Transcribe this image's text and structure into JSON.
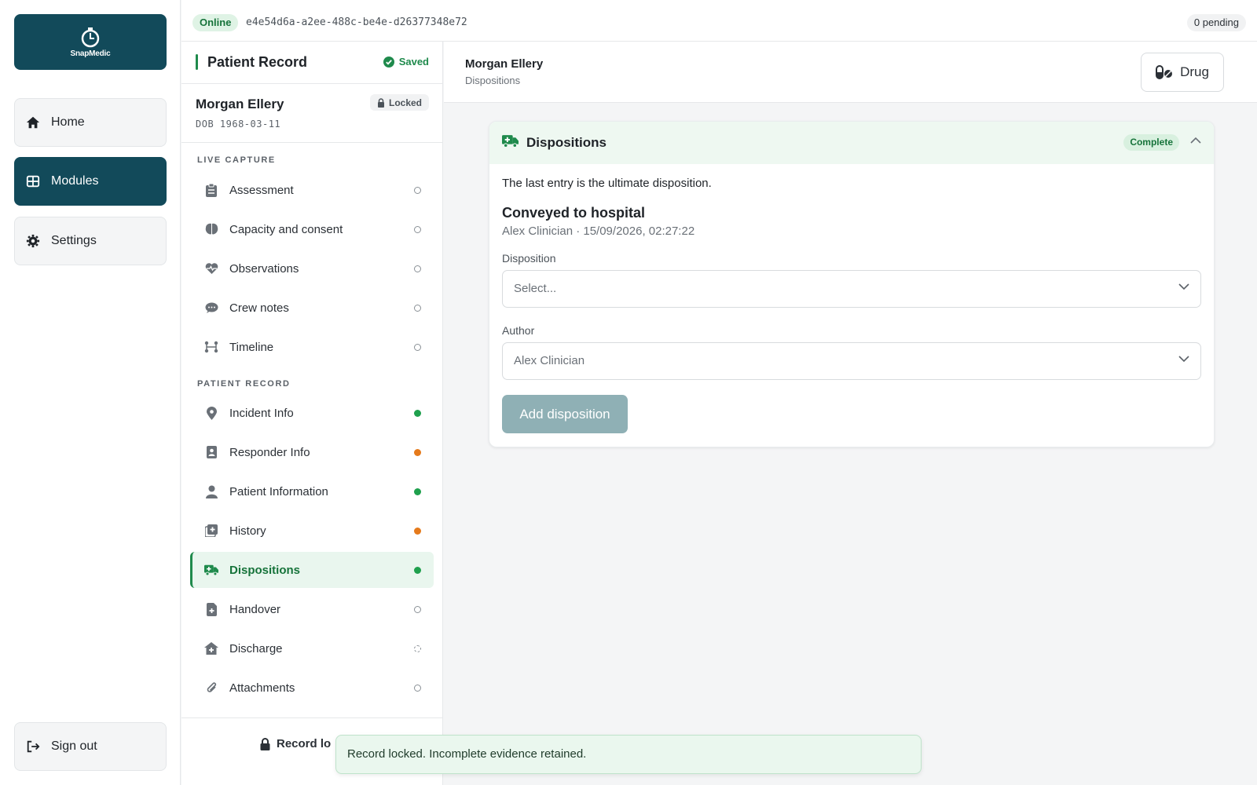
{
  "app": {
    "logo_text": "SnapMedic"
  },
  "nav": {
    "home": "Home",
    "modules": "Modules",
    "settings": "Settings",
    "signout": "Sign out"
  },
  "topbar": {
    "status": "Online",
    "record_id": "e4e54d6a-a2ee-488c-be4e-d26377348e72",
    "pending": "0 pending"
  },
  "record": {
    "title": "Patient Record",
    "saved": "Saved",
    "patient_name": "Morgan Ellery",
    "dob": "DOB 1968-03-11",
    "locked": "Locked",
    "sections": {
      "live_capture": "LIVE CAPTURE",
      "patient_record": "PATIENT RECORD"
    },
    "live_items": [
      {
        "label": "Assessment",
        "status": "empty"
      },
      {
        "label": "Capacity and consent",
        "status": "empty"
      },
      {
        "label": "Observations",
        "status": "empty"
      },
      {
        "label": "Crew notes",
        "status": "empty"
      },
      {
        "label": "Timeline",
        "status": "empty"
      }
    ],
    "record_items": [
      {
        "label": "Incident Info",
        "status": "complete"
      },
      {
        "label": "Responder Info",
        "status": "partial"
      },
      {
        "label": "Patient Information",
        "status": "complete"
      },
      {
        "label": "History",
        "status": "partial"
      },
      {
        "label": "Dispositions",
        "status": "complete"
      },
      {
        "label": "Handover",
        "status": "empty"
      },
      {
        "label": "Discharge",
        "status": "dashed"
      },
      {
        "label": "Attachments",
        "status": "empty"
      }
    ],
    "footer_btn": "Record lo"
  },
  "main": {
    "patient_name": "Morgan Ellery",
    "section": "Dispositions",
    "drug_btn": "Drug"
  },
  "card": {
    "title": "Dispositions",
    "badge": "Complete",
    "note": "The last entry is the ultimate disposition.",
    "last_title": "Conveyed to hospital",
    "last_meta": "Alex Clinician · 15/09/2026, 02:27:22",
    "disposition_label": "Disposition",
    "disposition_value": "Select...",
    "author_label": "Author",
    "author_value": "Alex Clinician",
    "add_btn": "Add disposition"
  },
  "toast": {
    "message": "Record locked. Incomplete evidence retained."
  },
  "colors": {
    "brand": "#124a5a",
    "green": "#1fa04d",
    "orange": "#e57a1b"
  }
}
